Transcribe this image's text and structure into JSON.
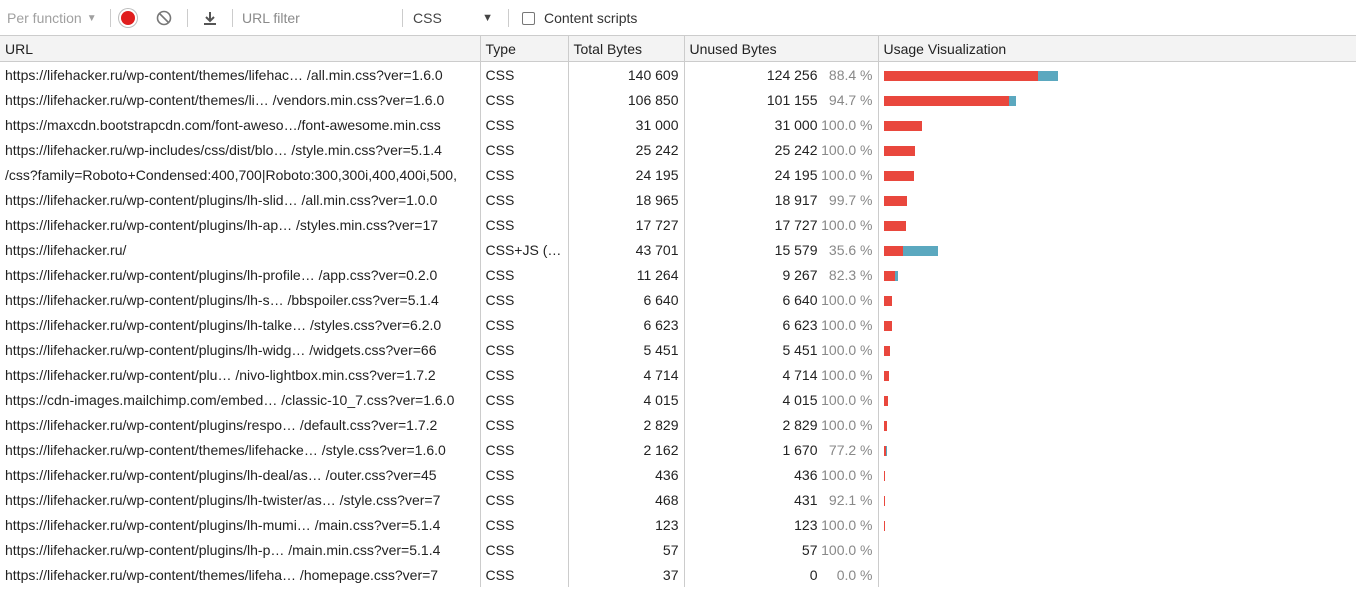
{
  "toolbar": {
    "per_function_label": "Per function",
    "record_icon": "record-icon",
    "clear_icon": "clear-icon",
    "download_icon": "download-icon",
    "url_filter_placeholder": "URL filter",
    "type_select_value": "CSS",
    "content_scripts_label": "Content scripts",
    "content_scripts_checked": false
  },
  "columns": [
    "URL",
    "Type",
    "Total Bytes",
    "Unused Bytes",
    "Usage Visualization"
  ],
  "colors": {
    "unused": "#e9473d",
    "used": "#5ba8bf"
  },
  "rows": [
    {
      "url": "https://lifehacker.ru/wp-content/themes/lifehac… /all.min.css?ver=1.6.0",
      "type": "CSS",
      "total": "140 609",
      "unused": "124 256",
      "pct": "88.4 %",
      "total_n": 140609,
      "unused_n": 124256
    },
    {
      "url": "https://lifehacker.ru/wp-content/themes/li… /vendors.min.css?ver=1.6.0",
      "type": "CSS",
      "total": "106 850",
      "unused": "101 155",
      "pct": "94.7 %",
      "total_n": 106850,
      "unused_n": 101155
    },
    {
      "url": "https://maxcdn.bootstrapcdn.com/font-aweso…/font-awesome.min.css",
      "type": "CSS",
      "total": "31 000",
      "unused": "31 000",
      "pct": "100.0 %",
      "total_n": 31000,
      "unused_n": 31000
    },
    {
      "url": "https://lifehacker.ru/wp-includes/css/dist/blo… /style.min.css?ver=5.1.4",
      "type": "CSS",
      "total": "25 242",
      "unused": "25 242",
      "pct": "100.0 %",
      "total_n": 25242,
      "unused_n": 25242
    },
    {
      "url": "/css?family=Roboto+Condensed:400,700|Roboto:300,300i,400,400i,500,",
      "type": "CSS",
      "total": "24 195",
      "unused": "24 195",
      "pct": "100.0 %",
      "total_n": 24195,
      "unused_n": 24195
    },
    {
      "url": "https://lifehacker.ru/wp-content/plugins/lh-slid… /all.min.css?ver=1.0.0",
      "type": "CSS",
      "total": "18 965",
      "unused": "18 917",
      "pct": "99.7 %",
      "total_n": 18965,
      "unused_n": 18917
    },
    {
      "url": "https://lifehacker.ru/wp-content/plugins/lh-ap… /styles.min.css?ver=17",
      "type": "CSS",
      "total": "17 727",
      "unused": "17 727",
      "pct": "100.0 %",
      "total_n": 17727,
      "unused_n": 17727
    },
    {
      "url": "https://lifehacker.ru/",
      "type": "CSS+JS (…",
      "total": "43 701",
      "unused": "15 579",
      "pct": "35.6 %",
      "total_n": 43701,
      "unused_n": 15579
    },
    {
      "url": "https://lifehacker.ru/wp-content/plugins/lh-profile… /app.css?ver=0.2.0",
      "type": "CSS",
      "total": "11 264",
      "unused": "9 267",
      "pct": "82.3 %",
      "total_n": 11264,
      "unused_n": 9267
    },
    {
      "url": "https://lifehacker.ru/wp-content/plugins/lh-s… /bbspoiler.css?ver=5.1.4",
      "type": "CSS",
      "total": "6 640",
      "unused": "6 640",
      "pct": "100.0 %",
      "total_n": 6640,
      "unused_n": 6640
    },
    {
      "url": "https://lifehacker.ru/wp-content/plugins/lh-talke… /styles.css?ver=6.2.0",
      "type": "CSS",
      "total": "6 623",
      "unused": "6 623",
      "pct": "100.0 %",
      "total_n": 6623,
      "unused_n": 6623
    },
    {
      "url": "https://lifehacker.ru/wp-content/plugins/lh-widg… /widgets.css?ver=66",
      "type": "CSS",
      "total": "5 451",
      "unused": "5 451",
      "pct": "100.0 %",
      "total_n": 5451,
      "unused_n": 5451
    },
    {
      "url": "https://lifehacker.ru/wp-content/plu… /nivo-lightbox.min.css?ver=1.7.2",
      "type": "CSS",
      "total": "4 714",
      "unused": "4 714",
      "pct": "100.0 %",
      "total_n": 4714,
      "unused_n": 4714
    },
    {
      "url": "https://cdn-images.mailchimp.com/embed… /classic-10_7.css?ver=1.6.0",
      "type": "CSS",
      "total": "4 015",
      "unused": "4 015",
      "pct": "100.0 %",
      "total_n": 4015,
      "unused_n": 4015
    },
    {
      "url": "https://lifehacker.ru/wp-content/plugins/respo… /default.css?ver=1.7.2",
      "type": "CSS",
      "total": "2 829",
      "unused": "2 829",
      "pct": "100.0 %",
      "total_n": 2829,
      "unused_n": 2829
    },
    {
      "url": "https://lifehacker.ru/wp-content/themes/lifehacke… /style.css?ver=1.6.0",
      "type": "CSS",
      "total": "2 162",
      "unused": "1 670",
      "pct": "77.2 %",
      "total_n": 2162,
      "unused_n": 1670
    },
    {
      "url": "https://lifehacker.ru/wp-content/plugins/lh-deal/as… /outer.css?ver=45",
      "type": "CSS",
      "total": "436",
      "unused": "436",
      "pct": "100.0 %",
      "total_n": 436,
      "unused_n": 436
    },
    {
      "url": "https://lifehacker.ru/wp-content/plugins/lh-twister/as… /style.css?ver=7",
      "type": "CSS",
      "total": "468",
      "unused": "431",
      "pct": "92.1 %",
      "total_n": 468,
      "unused_n": 431
    },
    {
      "url": "https://lifehacker.ru/wp-content/plugins/lh-mumi… /main.css?ver=5.1.4",
      "type": "CSS",
      "total": "123",
      "unused": "123",
      "pct": "100.0 %",
      "total_n": 123,
      "unused_n": 123
    },
    {
      "url": "https://lifehacker.ru/wp-content/plugins/lh-p… /main.min.css?ver=5.1.4",
      "type": "CSS",
      "total": "57",
      "unused": "57",
      "pct": "100.0 %",
      "total_n": 57,
      "unused_n": 57
    },
    {
      "url": "https://lifehacker.ru/wp-content/themes/lifeha… /homepage.css?ver=7",
      "type": "CSS",
      "total": "37",
      "unused": "0",
      "pct": "0.0 %",
      "total_n": 37,
      "unused_n": 0
    }
  ]
}
